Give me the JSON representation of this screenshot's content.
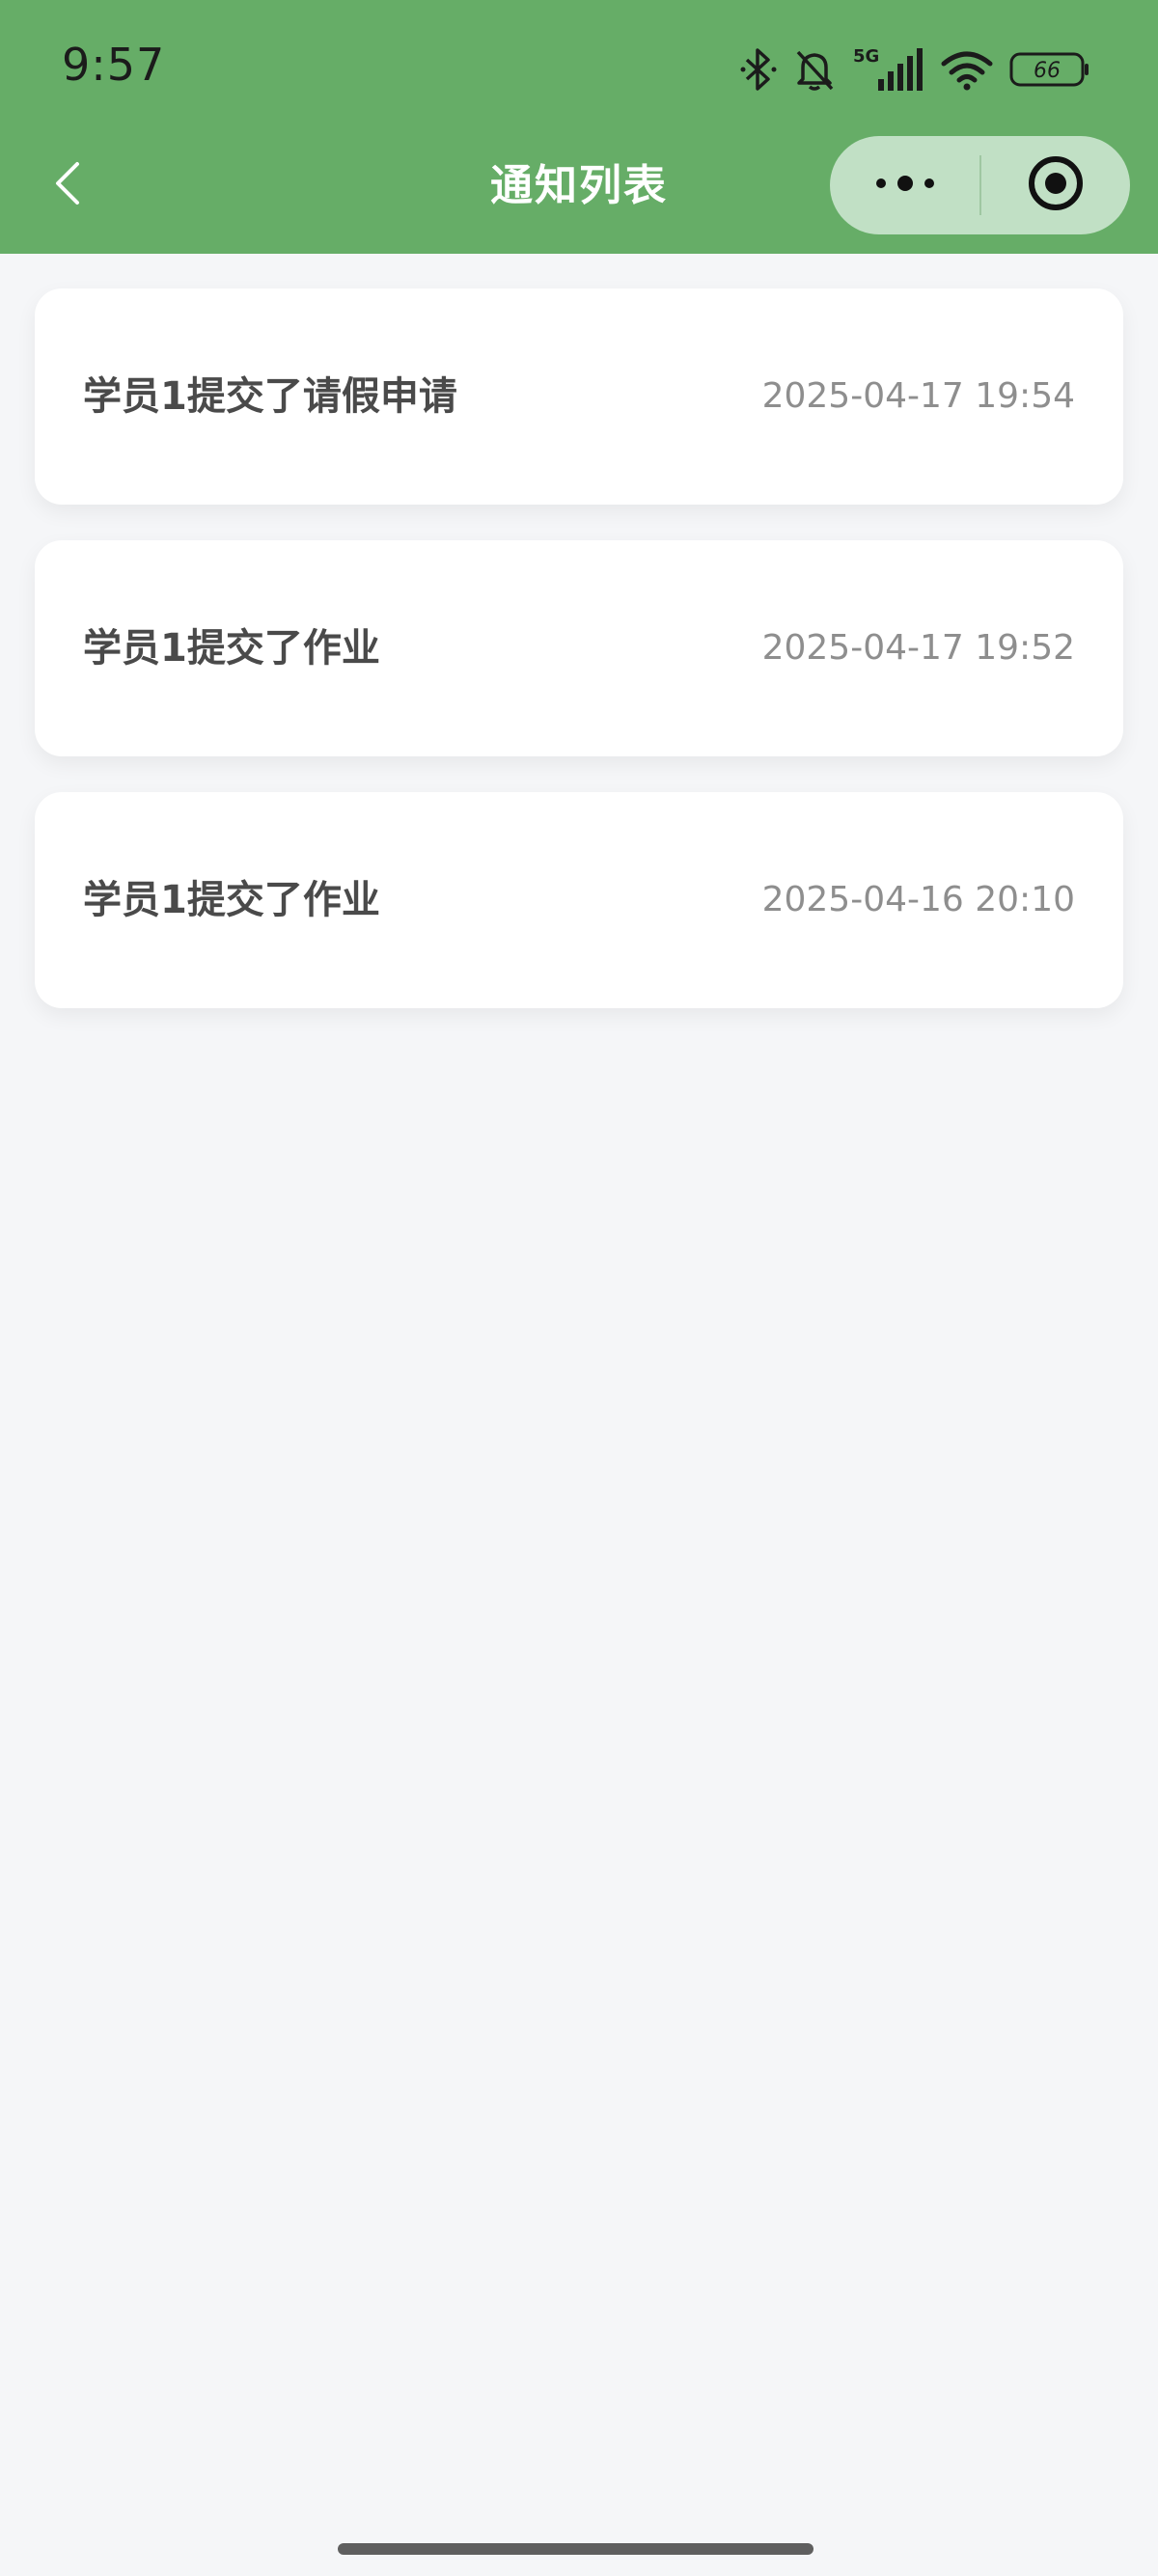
{
  "status_bar": {
    "time": "9:57",
    "network": "5G",
    "battery": "66",
    "icons": [
      "bluetooth-icon",
      "bell-muted-icon",
      "signal-5g-icon",
      "wifi-icon",
      "battery-icon"
    ]
  },
  "nav": {
    "title": "通知列表",
    "back_icon": "chevron-left-icon",
    "more_icon": "more-dots-icon",
    "close_icon": "target-close-icon"
  },
  "notifications": [
    {
      "title": "学员1提交了请假申请",
      "time": "2025-04-17 19:54"
    },
    {
      "title": "学员1提交了作业",
      "time": "2025-04-17 19:52"
    },
    {
      "title": "学员1提交了作业",
      "time": "2025-04-16 20:10"
    }
  ],
  "colors": {
    "header_bg": "#66ad67",
    "page_bg": "#f5f6f8",
    "card_bg": "#ffffff",
    "title_text": "#4a4a4a",
    "time_text": "#8e8e8e",
    "capsule_bg": "#c1e0c5"
  }
}
